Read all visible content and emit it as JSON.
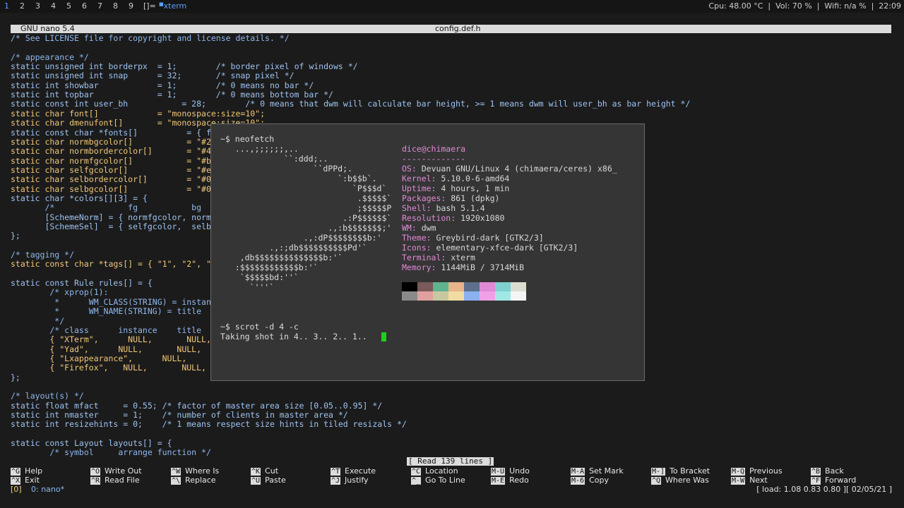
{
  "topbar": {
    "tags": [
      "1",
      "2",
      "3",
      "4",
      "5",
      "6",
      "7",
      "8",
      "9"
    ],
    "active_tag": "1",
    "layout": "[]=",
    "window_title": "xterm",
    "status": "Cpu: 48.00 °C  |  Vol: 70 %  |  Wifi: n/a %  |  22:09"
  },
  "nano": {
    "version": "GNU nano 5.4",
    "filename": "config.def.h",
    "code_lines": [
      "/* See LICENSE file for copyright and license details. */",
      "",
      "/* appearance */",
      "static unsigned int borderpx  = 1;        /* border pixel of windows */",
      "static unsigned int snap      = 32;       /* snap pixel */",
      "static int showbar            = 1;        /* 0 means no bar */",
      "static int topbar             = 1;        /* 0 means bottom bar */",
      "static const int user_bh           = 28;        /* 0 means that dwm will calculate bar height, >= 1 means dwm will user_bh as bar height */",
      "static char font[]            = \"monospace:size=10\";",
      "static char dmenufont[]       = \"monospace:size=10\";",
      "static const char *fonts[]          = { fo",
      "static char normbgcolor[]           = \"#22",
      "static char normbordercolor[]       = \"#44",
      "static char normfgcolor[]           = \"#bb",
      "static char selfgcolor[]            = \"#ee",
      "static char selbordercolor[]        = \"#00",
      "static char selbgcolor[]            = \"#00",
      "static char *colors[][3] = {",
      "       /*               fg           bg",
      "       [SchemeNorm] = { normfgcolor, normbg",
      "       [SchemeSel]  = { selfgcolor,  selbg",
      "};",
      "",
      "/* tagging */",
      "static const char *tags[] = { \"1\", \"2\", \"3",
      "",
      "static const Rule rules[] = {",
      "        /* xprop(1):",
      "         *      WM_CLASS(STRING) = instance",
      "         *      WM_NAME(STRING) = title",
      "         */",
      "        /* class      instance    title",
      "        { \"XTerm\",      NULL,       NULL,",
      "        { \"Yad\",      NULL,       NULL,",
      "        { \"Lxappearance\",      NULL,       ",
      "        { \"Firefox\",   NULL,       NULL,",
      "};",
      "",
      "/* layout(s) */",
      "static float mfact     = 0.55; /* factor of master area size [0.05..0.95] */",
      "static int nmaster     = 1;    /* number of clients in master area */",
      "static int resizehints = 0;    /* 1 means respect size hints in tiled resizals */",
      "",
      "static const Layout layouts[] = {",
      "        /* symbol     arrange function */"
    ],
    "read_message": "[ Read 139 lines ]",
    "shortcuts": [
      {
        "key": "^G",
        "label": "Help"
      },
      {
        "key": "^X",
        "label": "Exit"
      },
      {
        "key": "^O",
        "label": "Write Out"
      },
      {
        "key": "^R",
        "label": "Read File"
      },
      {
        "key": "^W",
        "label": "Where Is"
      },
      {
        "key": "^\\",
        "label": "Replace"
      },
      {
        "key": "^K",
        "label": "Cut"
      },
      {
        "key": "^U",
        "label": "Paste"
      },
      {
        "key": "^T",
        "label": "Execute"
      },
      {
        "key": "^J",
        "label": "Justify"
      },
      {
        "key": "^C",
        "label": "Location"
      },
      {
        "key": "^_",
        "label": "Go To Line"
      },
      {
        "key": "M-U",
        "label": "Undo"
      },
      {
        "key": "M-E",
        "label": "Redo"
      },
      {
        "key": "M-A",
        "label": "Set Mark"
      },
      {
        "key": "M-6",
        "label": "Copy"
      },
      {
        "key": "M-]",
        "label": "To Bracket"
      },
      {
        "key": "^Q",
        "label": "Where Was"
      },
      {
        "key": "M-Q",
        "label": "Previous"
      },
      {
        "key": "M-W",
        "label": "Next"
      },
      {
        "key": "^B",
        "label": "Back"
      },
      {
        "key": "^F",
        "label": "Forward"
      }
    ]
  },
  "tmux": {
    "session": "[0]",
    "window": "0: nano*",
    "right": "[ load: 1.08 0.83 0.80 ][ 02/05/21 ]"
  },
  "xterm": {
    "prompt1": "~$ neofetch",
    "ascii_art": [
      "   ...,;;;;;;,..",
      "             ``:ddd;..",
      "                   ``dPPd;.",
      "                        `:b$$b`.",
      "                           `P$$$d`",
      "                            .$$$$$`",
      "                            ;$$$$$P",
      "                         .:P$$$$$$`",
      "                      .,:b$$$$$$$;'",
      "                 .,:dP$$$$$$$$b:'",
      "          .,:;db$$$$$$$$$$Pd'`",
      "    ,db$$$$$$$$$$$$$$b:'`",
      "   :$$$$$$$$$$$$b:'`",
      "    `$$$$$bd:''`",
      "      `'''`"
    ],
    "user_host": "dice@chimaera",
    "separator": "-------------",
    "info": [
      {
        "label": "OS",
        "value": "Devuan GNU/Linux 4 (chimaera/ceres) x86_"
      },
      {
        "label": "Kernel",
        "value": "5.10.0-6-amd64"
      },
      {
        "label": "Uptime",
        "value": "4 hours, 1 min"
      },
      {
        "label": "Packages",
        "value": "861 (dpkg)"
      },
      {
        "label": "Shell",
        "value": "bash 5.1.4"
      },
      {
        "label": "Resolution",
        "value": "1920x1080"
      },
      {
        "label": "WM",
        "value": "dwm"
      },
      {
        "label": "Theme",
        "value": "Greybird-dark [GTK2/3]"
      },
      {
        "label": "Icons",
        "value": "elementary-xfce-dark [GTK2/3]"
      },
      {
        "label": "Terminal",
        "value": "xterm"
      },
      {
        "label": "Memory",
        "value": "1144MiB / 3714MiB"
      }
    ],
    "palette_top": [
      "#000000",
      "#7a5a5a",
      "#5fb38f",
      "#e8b48a",
      "#5d6f8c",
      "#e08ad6",
      "#7fd1cf",
      "#dcdcd0"
    ],
    "palette_bottom": [
      "#8a8a8a",
      "#e0a0a0",
      "#c8c8a0",
      "#f0dca0",
      "#8cb0f0",
      "#f0a0e6",
      "#a0e8e6",
      "#f4f4f4"
    ],
    "prompt2": "~$ scrot -d 4 -c",
    "output": "Taking shot in 4.. 3.. 2.. 1.. "
  }
}
